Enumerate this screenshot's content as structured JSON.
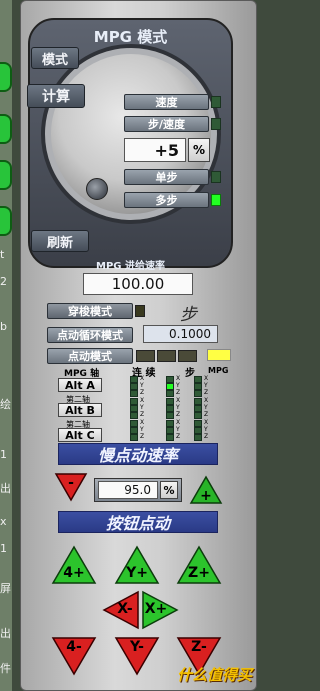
{
  "panel": {
    "title": "MPG 模式",
    "buttons": {
      "mode": "模式",
      "calc": "计算",
      "refresh": "刷新"
    },
    "speed_btn": "速度",
    "step_speed_btn": "步/速度",
    "single_step_btn": "单步",
    "multi_step_btn": "多步",
    "increment_value": "+5",
    "percent": "%",
    "feed_rate_label": "MPG 进给速率",
    "feed_rate_value": "100.00"
  },
  "jog": {
    "shuttle_mode": "穿梭模式",
    "step_label": "步",
    "cycle_mode": "点动循环模式",
    "cycle_value": "0.1000",
    "jog_mode": "点动模式",
    "headers": {
      "mpg_axis": "MPG 轴",
      "continuous": "连 续",
      "step": "步",
      "mpg": "MPG"
    },
    "axes": [
      {
        "name": "Alt A",
        "sub": ""
      },
      {
        "name": "Alt B",
        "sub": "第二轴"
      },
      {
        "name": "Alt C",
        "sub": "第二轴"
      }
    ],
    "axis_letters": [
      "X",
      "Y",
      "Z"
    ],
    "slow_rate_bar": "慢点动速率",
    "rate_value": "95.0",
    "rate_unit": "%",
    "button_jog_bar": "按钮点动",
    "keys": {
      "x_plus": "X+",
      "x_minus": "X-",
      "y_plus": "Y+",
      "y_minus": "Y-",
      "z_plus": "Z+",
      "z_minus": "Z-",
      "a_plus": "4+",
      "a_minus": "4-"
    }
  },
  "side_strip": {
    "labels": [
      "t",
      "2",
      "b",
      "绘",
      "1",
      "出",
      "x",
      "1",
      "屏",
      "出",
      "件"
    ]
  },
  "watermark": "什么值得买"
}
